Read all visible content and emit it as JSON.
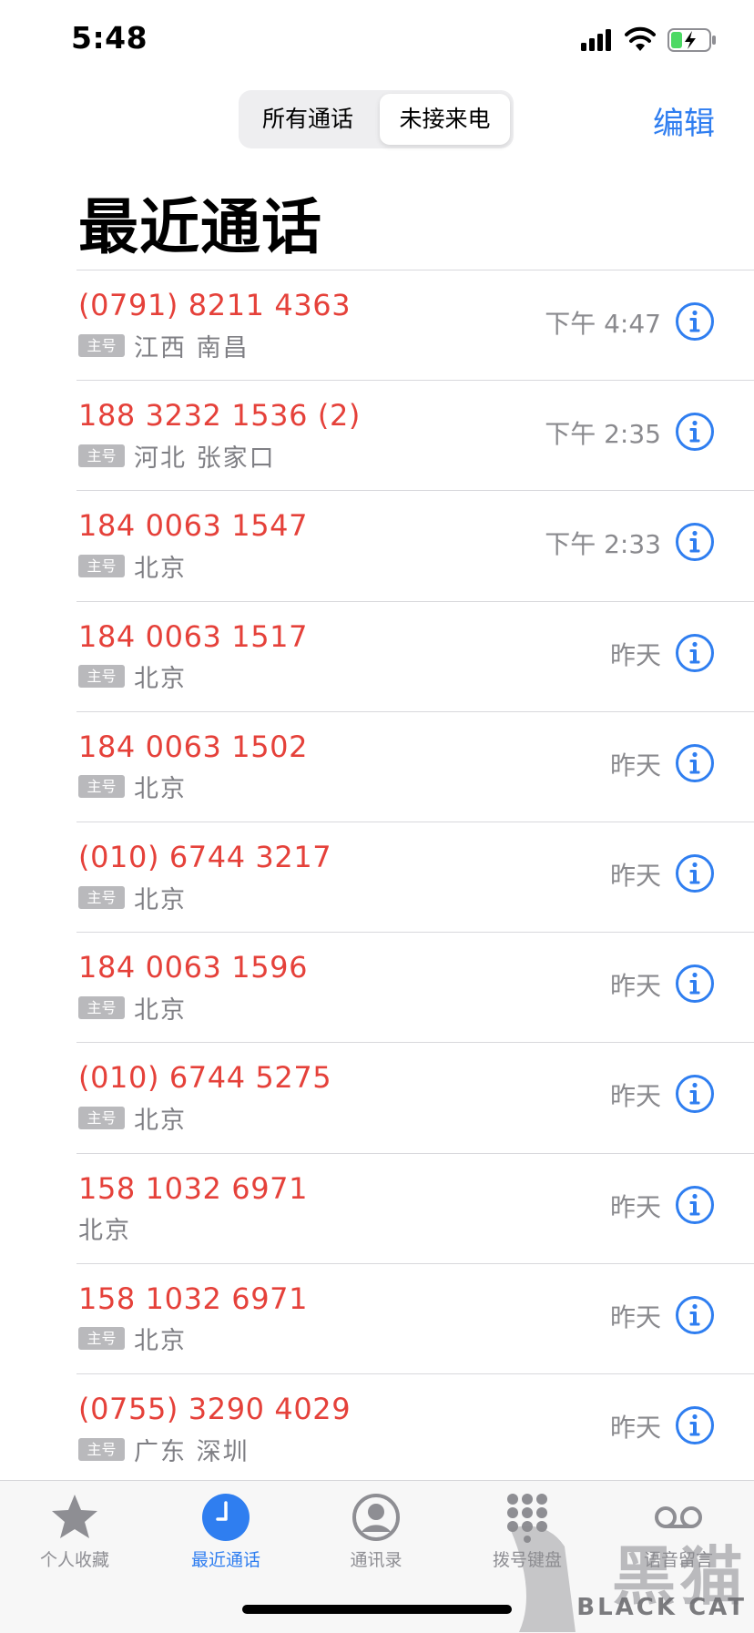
{
  "status_bar": {
    "time": "5:48"
  },
  "header": {
    "segments": [
      "所有通话",
      "未接来电"
    ],
    "selected_segment": "未接来电",
    "edit_label": "编辑",
    "title": "最近通话"
  },
  "colors": {
    "accent": "#2f7ef0",
    "missed": "#e5413a",
    "secondary_text": "#8a8a8e"
  },
  "calls": [
    {
      "number": "(0791) 8211 4363",
      "badge": "主号",
      "location": "江西 南昌",
      "time": "下午 4:47"
    },
    {
      "number": "188 3232 1536 (2)",
      "badge": "主号",
      "location": "河北 张家口",
      "time": "下午 2:35"
    },
    {
      "number": "184 0063 1547",
      "badge": "主号",
      "location": "北京",
      "time": "下午 2:33"
    },
    {
      "number": "184 0063 1517",
      "badge": "主号",
      "location": "北京",
      "time": "昨天"
    },
    {
      "number": "184 0063 1502",
      "badge": "主号",
      "location": "北京",
      "time": "昨天"
    },
    {
      "number": "(010) 6744 3217",
      "badge": "主号",
      "location": "北京",
      "time": "昨天"
    },
    {
      "number": "184 0063 1596",
      "badge": "主号",
      "location": "北京",
      "time": "昨天"
    },
    {
      "number": "(010) 6744 5275",
      "badge": "主号",
      "location": "北京",
      "time": "昨天"
    },
    {
      "number": "158 1032 6971",
      "badge": "",
      "location": "北京",
      "time": "昨天"
    },
    {
      "number": "158 1032 6971",
      "badge": "主号",
      "location": "北京",
      "time": "昨天"
    },
    {
      "number": "(0755) 3290 4029",
      "badge": "主号",
      "location": "广东 深圳",
      "time": "昨天"
    }
  ],
  "tabbar": {
    "items": [
      {
        "label": "个人收藏",
        "icon": "star-icon"
      },
      {
        "label": "最近通话",
        "icon": "clock-icon",
        "active": true
      },
      {
        "label": "通讯录",
        "icon": "person-icon"
      },
      {
        "label": "拨号键盘",
        "icon": "keypad-icon"
      },
      {
        "label": "语音留言",
        "icon": "voicemail-icon"
      }
    ]
  },
  "watermark": {
    "text": "BLACK CAT",
    "chinese": "黑猫"
  }
}
